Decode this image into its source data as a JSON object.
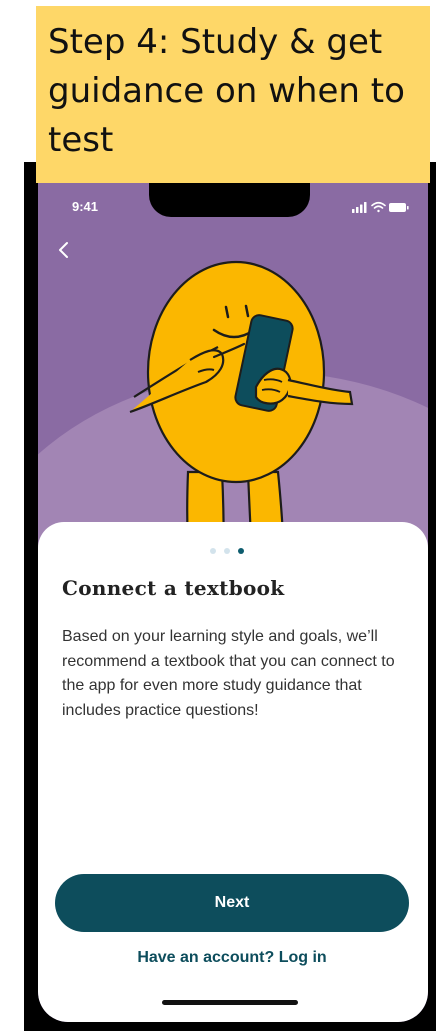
{
  "banner": {
    "text": "Step 4: Study & get guidance on when to test"
  },
  "status_bar": {
    "time": "9:41",
    "icons": [
      "signal-icon",
      "wifi-icon",
      "battery-icon"
    ]
  },
  "nav": {
    "back_icon": "chevron-left-icon"
  },
  "illustration": {
    "icon": "character-holding-phone-illustration"
  },
  "pager": {
    "total": 3,
    "current": 3
  },
  "card": {
    "title": "Connect a textbook",
    "body": "Based on your learning style and goals, we’ll recommend a textbook that you can connect to the app for even more study guidance that includes practice questions!"
  },
  "actions": {
    "next_label": "Next",
    "login_label": "Have an account? Log in"
  },
  "colors": {
    "banner": "#fed768",
    "background_purple": "#8a6ba3",
    "hill": "#a285b4",
    "character_yellow": "#fbb700",
    "primary": "#0d4d5c",
    "dot_inactive": "#d3e3ec",
    "dot_active": "#0d5c6e"
  }
}
